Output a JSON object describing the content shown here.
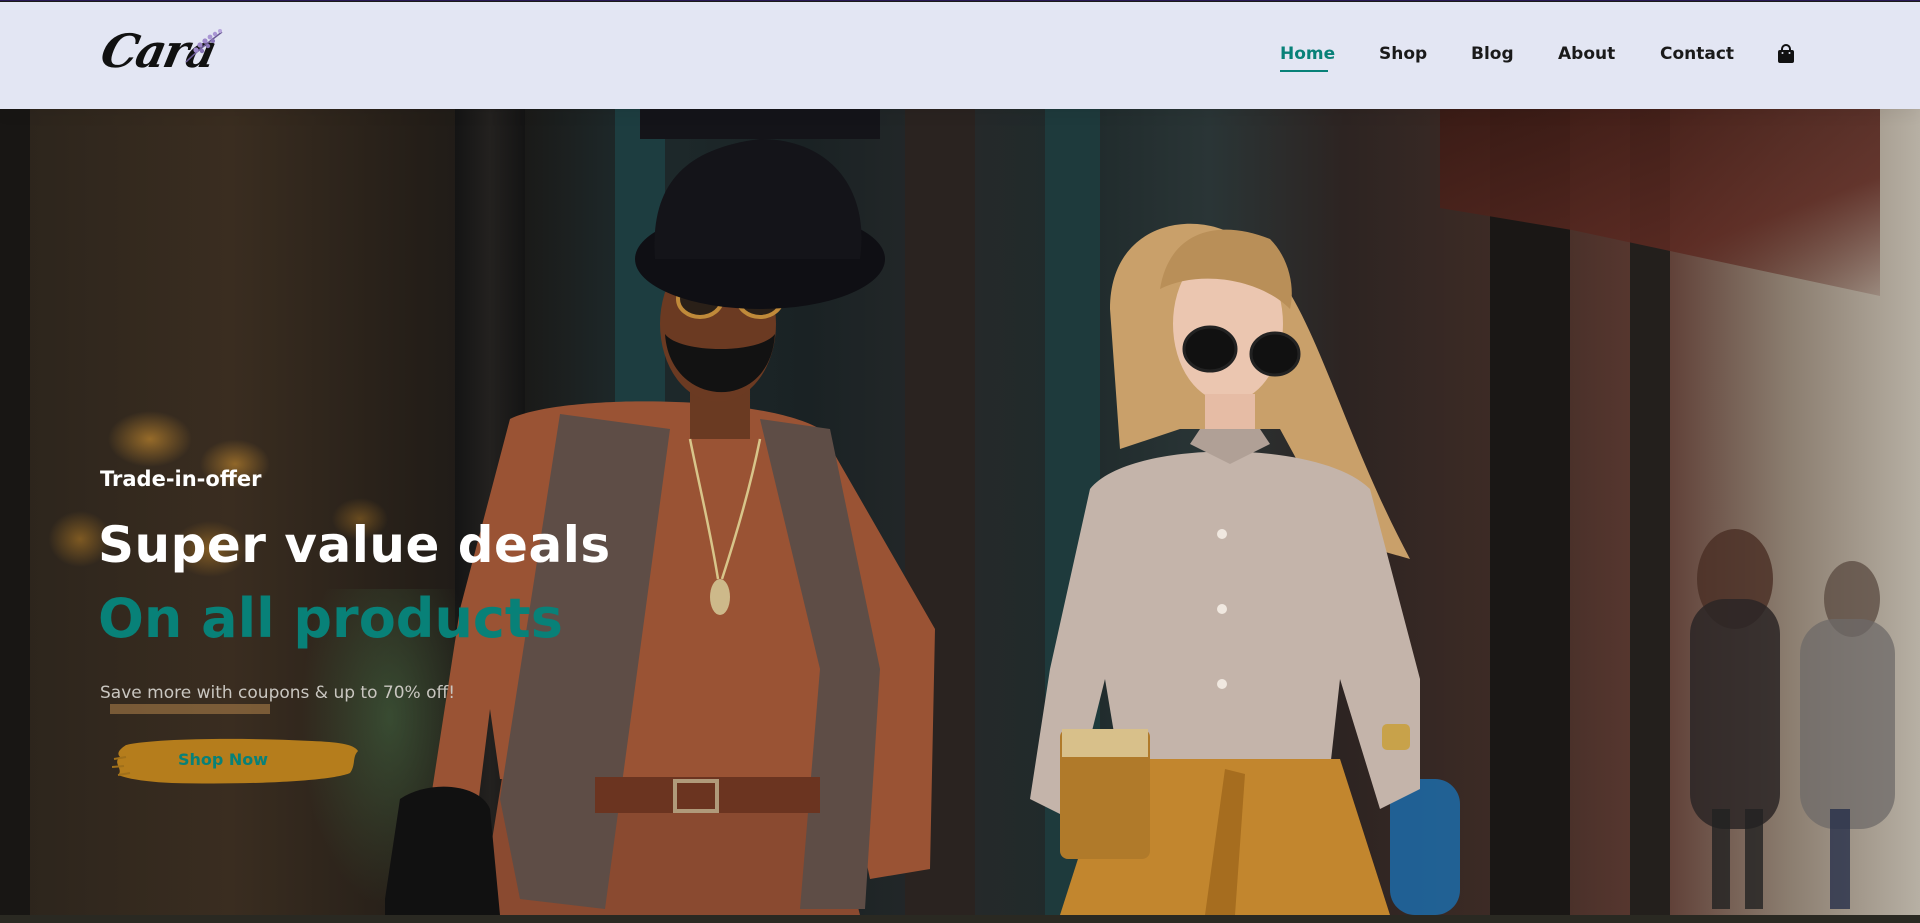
{
  "brand": {
    "logo_text": "Cara"
  },
  "nav": {
    "items": [
      {
        "label": "Home",
        "active": true
      },
      {
        "label": "Shop",
        "active": false
      },
      {
        "label": "Blog",
        "active": false
      },
      {
        "label": "About",
        "active": false
      },
      {
        "label": "Contact",
        "active": false
      }
    ],
    "cart_icon": "shopping-bag-icon"
  },
  "hero": {
    "eyebrow": "Trade-in-offer",
    "headline_1": "Super value deals",
    "headline_2": "On all products",
    "subtext": "Save more with coupons & up to 70% off!",
    "cta_label": "Shop Now"
  },
  "colors": {
    "accent": "#088178",
    "header_bg": "#e3e6f3",
    "text_dark": "#1a1a1a",
    "button_brush": "#b9801c"
  }
}
